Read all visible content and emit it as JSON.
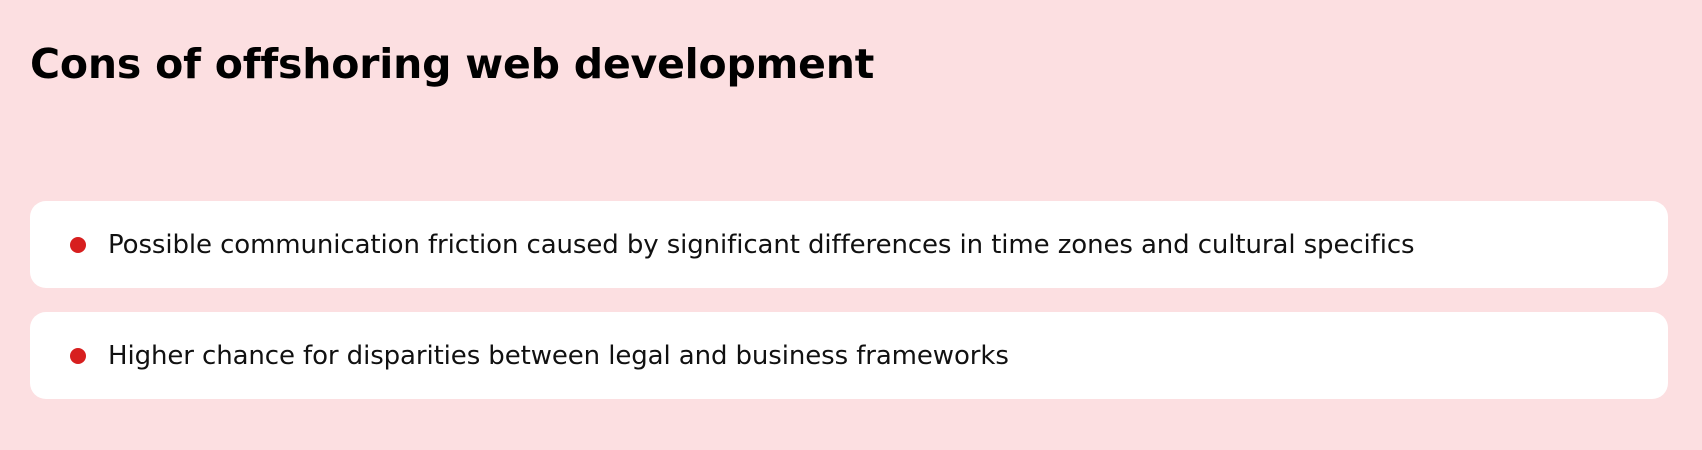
{
  "page": {
    "title": "Cons of offshoring web development"
  },
  "cons": {
    "items": [
      {
        "text": "Possible communication friction caused by significant differences in time zones and cultural specifics"
      },
      {
        "text": "Higher chance for disparities between legal and business frameworks"
      }
    ]
  },
  "colors": {
    "background": "#fcdfe1",
    "card": "#ffffff",
    "bullet": "#d71f1f",
    "title_text": "#000000",
    "body_text": "#111111"
  },
  "icons": {
    "bullet": "bullet-dot-icon"
  }
}
